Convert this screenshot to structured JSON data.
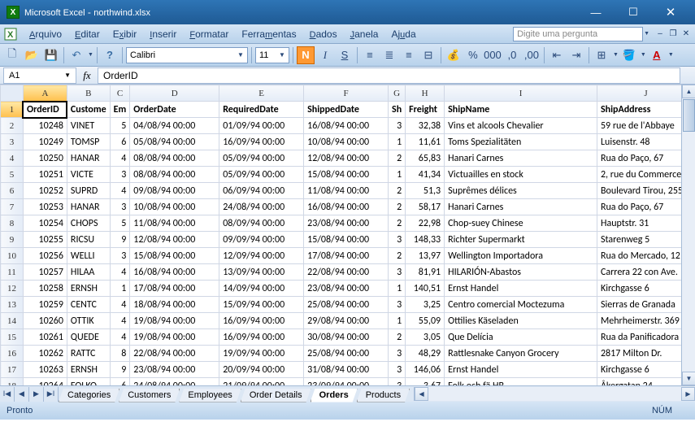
{
  "window": {
    "app": "Microsoft Excel",
    "file": "northwind.xlsx"
  },
  "menus": [
    "Arquivo",
    "Editar",
    "Exibir",
    "Inserir",
    "Formatar",
    "Ferramentas",
    "Dados",
    "Janela",
    "Ajuda"
  ],
  "ask_placeholder": "Digite uma pergunta",
  "font": {
    "name": "Calibri",
    "size": "11"
  },
  "namebox": "A1",
  "formula": "OrderID",
  "columns": [
    "A",
    "B",
    "C",
    "D",
    "E",
    "F",
    "G",
    "H",
    "I",
    "J"
  ],
  "headers": [
    "OrderID",
    "CustomerID",
    "EmployeeID",
    "OrderDate",
    "RequiredDate",
    "ShippedDate",
    "ShipVia",
    "Freight",
    "ShipName",
    "ShipAddress"
  ],
  "headers_display": [
    "OrderID",
    "Custome",
    "Em",
    "OrderDate",
    "RequiredDate",
    "ShippedDate",
    "Sh",
    "Freight",
    "ShipName",
    "ShipAddress"
  ],
  "rows": [
    [
      "10248",
      "VINET",
      "5",
      "04/08/94 00:00",
      "01/09/94 00:00",
      "16/08/94 00:00",
      "3",
      "32,38",
      "Vins et alcools Chevalier",
      "59 rue de l'Abbaye"
    ],
    [
      "10249",
      "TOMSP",
      "6",
      "05/08/94 00:00",
      "16/09/94 00:00",
      "10/08/94 00:00",
      "1",
      "11,61",
      "Toms Spezialitäten",
      "Luisenstr. 48"
    ],
    [
      "10250",
      "HANAR",
      "4",
      "08/08/94 00:00",
      "05/09/94 00:00",
      "12/08/94 00:00",
      "2",
      "65,83",
      "Hanari Carnes",
      "Rua do Paço, 67"
    ],
    [
      "10251",
      "VICTE",
      "3",
      "08/08/94 00:00",
      "05/09/94 00:00",
      "15/08/94 00:00",
      "1",
      "41,34",
      "Victuailles en stock",
      "2, rue du Commerce"
    ],
    [
      "10252",
      "SUPRD",
      "4",
      "09/08/94 00:00",
      "06/09/94 00:00",
      "11/08/94 00:00",
      "2",
      "51,3",
      "Suprêmes délices",
      "Boulevard Tirou, 255"
    ],
    [
      "10253",
      "HANAR",
      "3",
      "10/08/94 00:00",
      "24/08/94 00:00",
      "16/08/94 00:00",
      "2",
      "58,17",
      "Hanari Carnes",
      "Rua do Paço, 67"
    ],
    [
      "10254",
      "CHOPS",
      "5",
      "11/08/94 00:00",
      "08/09/94 00:00",
      "23/08/94 00:00",
      "2",
      "22,98",
      "Chop-suey Chinese",
      "Hauptstr. 31"
    ],
    [
      "10255",
      "RICSU",
      "9",
      "12/08/94 00:00",
      "09/09/94 00:00",
      "15/08/94 00:00",
      "3",
      "148,33",
      "Richter Supermarkt",
      "Starenweg 5"
    ],
    [
      "10256",
      "WELLI",
      "3",
      "15/08/94 00:00",
      "12/09/94 00:00",
      "17/08/94 00:00",
      "2",
      "13,97",
      "Wellington Importadora",
      "Rua do Mercado, 12"
    ],
    [
      "10257",
      "HILAA",
      "4",
      "16/08/94 00:00",
      "13/09/94 00:00",
      "22/08/94 00:00",
      "3",
      "81,91",
      "HILARIÓN-Abastos",
      "Carrera 22 con Ave."
    ],
    [
      "10258",
      "ERNSH",
      "1",
      "17/08/94 00:00",
      "14/09/94 00:00",
      "23/08/94 00:00",
      "1",
      "140,51",
      "Ernst Handel",
      "Kirchgasse 6"
    ],
    [
      "10259",
      "CENTC",
      "4",
      "18/08/94 00:00",
      "15/09/94 00:00",
      "25/08/94 00:00",
      "3",
      "3,25",
      "Centro comercial Moctezuma",
      "Sierras de Granada"
    ],
    [
      "10260",
      "OTTIK",
      "4",
      "19/08/94 00:00",
      "16/09/94 00:00",
      "29/08/94 00:00",
      "1",
      "55,09",
      "Ottilies Käseladen",
      "Mehrheimerstr. 369"
    ],
    [
      "10261",
      "QUEDE",
      "4",
      "19/08/94 00:00",
      "16/09/94 00:00",
      "30/08/94 00:00",
      "2",
      "3,05",
      "Que Delícia",
      "Rua da Panificadora"
    ],
    [
      "10262",
      "RATTC",
      "8",
      "22/08/94 00:00",
      "19/09/94 00:00",
      "25/08/94 00:00",
      "3",
      "48,29",
      "Rattlesnake Canyon Grocery",
      "2817 Milton Dr."
    ],
    [
      "10263",
      "ERNSH",
      "9",
      "23/08/94 00:00",
      "20/09/94 00:00",
      "31/08/94 00:00",
      "3",
      "146,06",
      "Ernst Handel",
      "Kirchgasse 6"
    ],
    [
      "10264",
      "FOLKO",
      "6",
      "24/08/94 00:00",
      "21/09/94 00:00",
      "23/09/94 00:00",
      "3",
      "3,67",
      "Folk och fä HB",
      "Åkergatan 24"
    ]
  ],
  "tabs": [
    "Categories",
    "Customers",
    "Employees",
    "Order Details",
    "Orders",
    "Products"
  ],
  "active_tab": 4,
  "status": {
    "left": "Pronto",
    "num": "NÚM"
  }
}
